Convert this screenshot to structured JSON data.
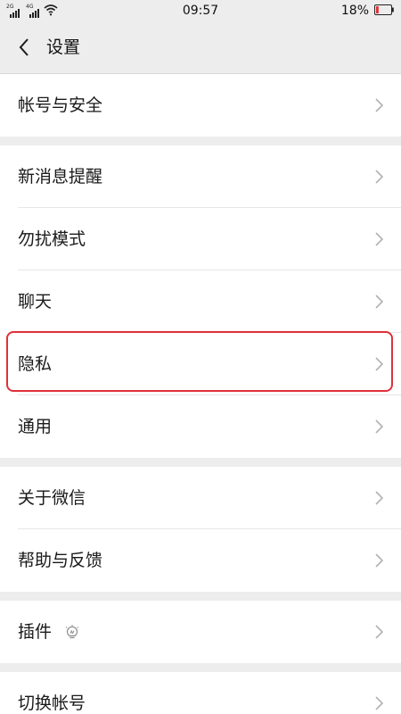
{
  "status_bar": {
    "signal_1": "2G",
    "signal_2": "4G",
    "time": "09:57",
    "battery": "18%",
    "battery_level": 0.18,
    "battery_color": "#e0303a"
  },
  "header": {
    "back_icon": "chevron-left-icon",
    "title": "设置"
  },
  "groups": [
    {
      "items": [
        {
          "label": "帐号与安全"
        }
      ]
    },
    {
      "items": [
        {
          "label": "新消息提醒"
        },
        {
          "label": "勿扰模式"
        },
        {
          "label": "聊天"
        },
        {
          "label": "隐私",
          "highlighted": true
        },
        {
          "label": "通用"
        }
      ]
    },
    {
      "items": [
        {
          "label": "关于微信"
        },
        {
          "label": "帮助与反馈"
        }
      ]
    },
    {
      "items": [
        {
          "label": "插件",
          "icon": "plugin-bulb-icon"
        }
      ]
    },
    {
      "items": [
        {
          "label": "切换帐号"
        }
      ]
    }
  ],
  "colors": {
    "background": "#ededed",
    "surface": "#ffffff",
    "text": "#1a1a1a",
    "chevron": "#b2b2b2",
    "highlight": "#e0303a"
  }
}
